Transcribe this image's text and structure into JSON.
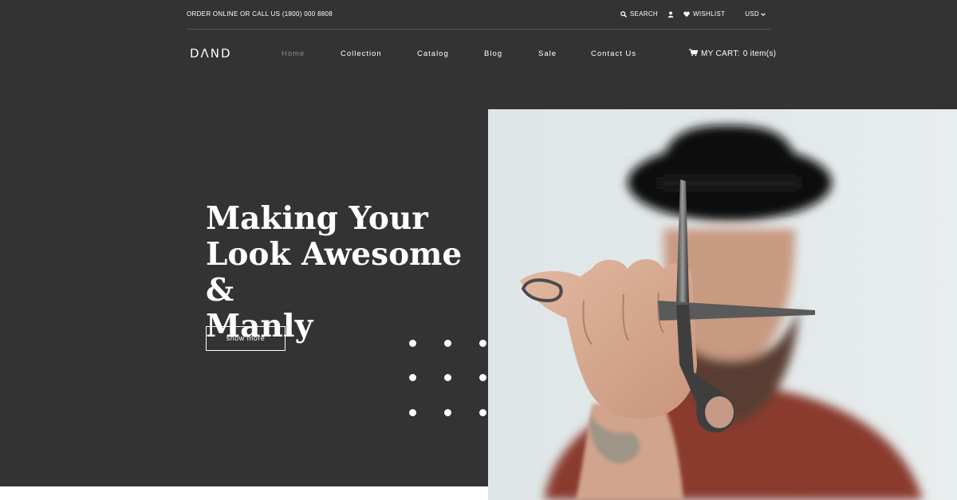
{
  "topbar": {
    "phone_text": "ORDER ONLINE OR CALL US (1800) 000 8808",
    "search_label": "SEARCH",
    "wishlist_label": "WISHLIST",
    "currency": "USD"
  },
  "brand": {
    "logo_text": "DΛND"
  },
  "nav": {
    "items": [
      {
        "label": "Home",
        "active": true
      },
      {
        "label": "Collection"
      },
      {
        "label": "Catalog"
      },
      {
        "label": "Blog"
      },
      {
        "label": "Sale"
      },
      {
        "label": "Contact Us"
      }
    ]
  },
  "cart": {
    "label": "MY CART:",
    "count": "0 item(s)"
  },
  "hero": {
    "title_lines": [
      "Making Your",
      "Look Awesome &",
      "Manly"
    ],
    "button_label": "show more"
  },
  "icons": {
    "search": "search-icon",
    "user": "user-icon",
    "wishlist": "heart-icon",
    "currency": "chevron-down-icon",
    "cart": "cart-icon"
  },
  "colors": {
    "background_dark": "#333333",
    "text": "#ffffff",
    "nav_active": "#8a8a8a"
  }
}
